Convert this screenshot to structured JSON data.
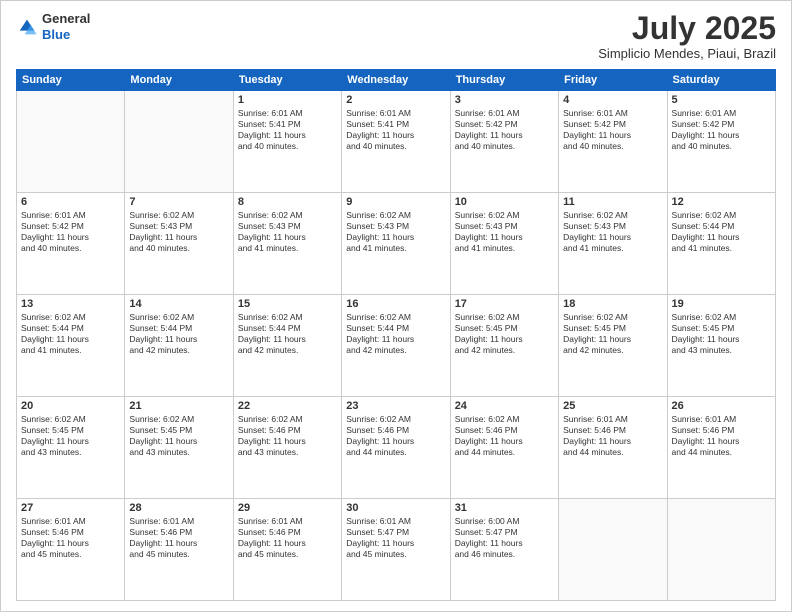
{
  "header": {
    "logo_general": "General",
    "logo_blue": "Blue",
    "month_title": "July 2025",
    "subtitle": "Simplicio Mendes, Piaui, Brazil"
  },
  "days_of_week": [
    "Sunday",
    "Monday",
    "Tuesday",
    "Wednesday",
    "Thursday",
    "Friday",
    "Saturday"
  ],
  "weeks": [
    [
      {
        "day": "",
        "info": ""
      },
      {
        "day": "",
        "info": ""
      },
      {
        "day": "1",
        "info": "Sunrise: 6:01 AM\nSunset: 5:41 PM\nDaylight: 11 hours\nand 40 minutes."
      },
      {
        "day": "2",
        "info": "Sunrise: 6:01 AM\nSunset: 5:41 PM\nDaylight: 11 hours\nand 40 minutes."
      },
      {
        "day": "3",
        "info": "Sunrise: 6:01 AM\nSunset: 5:42 PM\nDaylight: 11 hours\nand 40 minutes."
      },
      {
        "day": "4",
        "info": "Sunrise: 6:01 AM\nSunset: 5:42 PM\nDaylight: 11 hours\nand 40 minutes."
      },
      {
        "day": "5",
        "info": "Sunrise: 6:01 AM\nSunset: 5:42 PM\nDaylight: 11 hours\nand 40 minutes."
      }
    ],
    [
      {
        "day": "6",
        "info": "Sunrise: 6:01 AM\nSunset: 5:42 PM\nDaylight: 11 hours\nand 40 minutes."
      },
      {
        "day": "7",
        "info": "Sunrise: 6:02 AM\nSunset: 5:43 PM\nDaylight: 11 hours\nand 40 minutes."
      },
      {
        "day": "8",
        "info": "Sunrise: 6:02 AM\nSunset: 5:43 PM\nDaylight: 11 hours\nand 41 minutes."
      },
      {
        "day": "9",
        "info": "Sunrise: 6:02 AM\nSunset: 5:43 PM\nDaylight: 11 hours\nand 41 minutes."
      },
      {
        "day": "10",
        "info": "Sunrise: 6:02 AM\nSunset: 5:43 PM\nDaylight: 11 hours\nand 41 minutes."
      },
      {
        "day": "11",
        "info": "Sunrise: 6:02 AM\nSunset: 5:43 PM\nDaylight: 11 hours\nand 41 minutes."
      },
      {
        "day": "12",
        "info": "Sunrise: 6:02 AM\nSunset: 5:44 PM\nDaylight: 11 hours\nand 41 minutes."
      }
    ],
    [
      {
        "day": "13",
        "info": "Sunrise: 6:02 AM\nSunset: 5:44 PM\nDaylight: 11 hours\nand 41 minutes."
      },
      {
        "day": "14",
        "info": "Sunrise: 6:02 AM\nSunset: 5:44 PM\nDaylight: 11 hours\nand 42 minutes."
      },
      {
        "day": "15",
        "info": "Sunrise: 6:02 AM\nSunset: 5:44 PM\nDaylight: 11 hours\nand 42 minutes."
      },
      {
        "day": "16",
        "info": "Sunrise: 6:02 AM\nSunset: 5:44 PM\nDaylight: 11 hours\nand 42 minutes."
      },
      {
        "day": "17",
        "info": "Sunrise: 6:02 AM\nSunset: 5:45 PM\nDaylight: 11 hours\nand 42 minutes."
      },
      {
        "day": "18",
        "info": "Sunrise: 6:02 AM\nSunset: 5:45 PM\nDaylight: 11 hours\nand 42 minutes."
      },
      {
        "day": "19",
        "info": "Sunrise: 6:02 AM\nSunset: 5:45 PM\nDaylight: 11 hours\nand 43 minutes."
      }
    ],
    [
      {
        "day": "20",
        "info": "Sunrise: 6:02 AM\nSunset: 5:45 PM\nDaylight: 11 hours\nand 43 minutes."
      },
      {
        "day": "21",
        "info": "Sunrise: 6:02 AM\nSunset: 5:45 PM\nDaylight: 11 hours\nand 43 minutes."
      },
      {
        "day": "22",
        "info": "Sunrise: 6:02 AM\nSunset: 5:46 PM\nDaylight: 11 hours\nand 43 minutes."
      },
      {
        "day": "23",
        "info": "Sunrise: 6:02 AM\nSunset: 5:46 PM\nDaylight: 11 hours\nand 44 minutes."
      },
      {
        "day": "24",
        "info": "Sunrise: 6:02 AM\nSunset: 5:46 PM\nDaylight: 11 hours\nand 44 minutes."
      },
      {
        "day": "25",
        "info": "Sunrise: 6:01 AM\nSunset: 5:46 PM\nDaylight: 11 hours\nand 44 minutes."
      },
      {
        "day": "26",
        "info": "Sunrise: 6:01 AM\nSunset: 5:46 PM\nDaylight: 11 hours\nand 44 minutes."
      }
    ],
    [
      {
        "day": "27",
        "info": "Sunrise: 6:01 AM\nSunset: 5:46 PM\nDaylight: 11 hours\nand 45 minutes."
      },
      {
        "day": "28",
        "info": "Sunrise: 6:01 AM\nSunset: 5:46 PM\nDaylight: 11 hours\nand 45 minutes."
      },
      {
        "day": "29",
        "info": "Sunrise: 6:01 AM\nSunset: 5:46 PM\nDaylight: 11 hours\nand 45 minutes."
      },
      {
        "day": "30",
        "info": "Sunrise: 6:01 AM\nSunset: 5:47 PM\nDaylight: 11 hours\nand 45 minutes."
      },
      {
        "day": "31",
        "info": "Sunrise: 6:00 AM\nSunset: 5:47 PM\nDaylight: 11 hours\nand 46 minutes."
      },
      {
        "day": "",
        "info": ""
      },
      {
        "day": "",
        "info": ""
      }
    ]
  ]
}
